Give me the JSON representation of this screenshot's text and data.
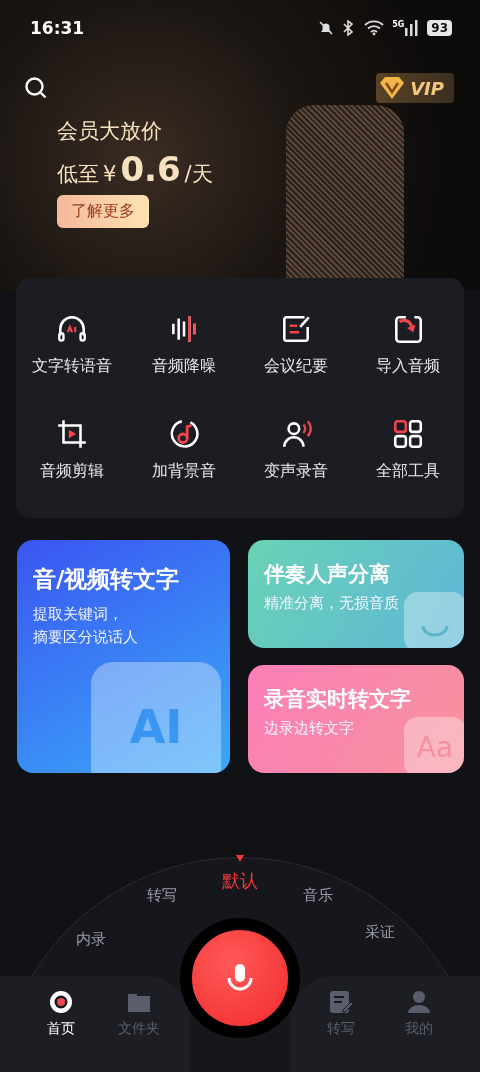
{
  "status_bar": {
    "time": "16:31",
    "network": "5G",
    "battery": "93"
  },
  "banner": {
    "vip_label": "VIP",
    "headline": "会员大放价",
    "price_prefix": "低至",
    "currency": "¥",
    "price": "0.6",
    "price_unit": "/天",
    "button": "了解更多"
  },
  "tools": [
    {
      "label": "文字转语音",
      "kind": "headphones"
    },
    {
      "label": "音频降噪",
      "kind": "wave"
    },
    {
      "label": "会议纪要",
      "kind": "note"
    },
    {
      "label": "导入音频",
      "kind": "import"
    },
    {
      "label": "音频剪辑",
      "kind": "crop"
    },
    {
      "label": "加背景音",
      "kind": "music"
    },
    {
      "label": "变声录音",
      "kind": "voice"
    },
    {
      "label": "全部工具",
      "kind": "grid"
    }
  ],
  "feature_cards": [
    {
      "title": "音/视频转文字",
      "subtitle_lines": [
        "提取关键词，",
        "摘要区分说话人"
      ],
      "kind": "ai",
      "art_text": "AI"
    },
    {
      "title": "伴奏人声分离",
      "subtitle_lines": [
        "精准分离，无损音质"
      ],
      "kind": "smile"
    },
    {
      "title": "录音实时转文字",
      "subtitle_lines": [
        "边录边转文字"
      ],
      "kind": "letters",
      "art_text": "Aa"
    }
  ],
  "record_modes": [
    {
      "label": "内录",
      "selected": false
    },
    {
      "label": "转写",
      "selected": false
    },
    {
      "label": "默认",
      "selected": true
    },
    {
      "label": "音乐",
      "selected": false
    },
    {
      "label": "采证",
      "selected": false
    }
  ],
  "tab_bar": [
    {
      "label": "首页",
      "kind": "home",
      "selected": true
    },
    {
      "label": "文件夹",
      "kind": "folder",
      "selected": false
    },
    {
      "label": "转写",
      "kind": "transcribe",
      "selected": false
    },
    {
      "label": "我的",
      "kind": "profile",
      "selected": false
    }
  ]
}
